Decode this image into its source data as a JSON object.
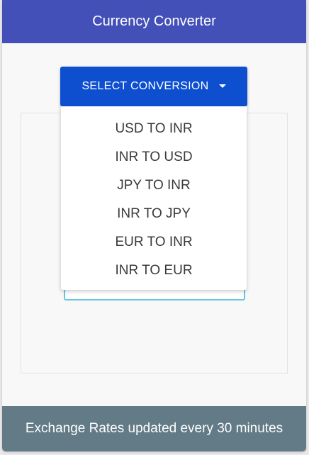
{
  "header": {
    "title": "Currency Converter"
  },
  "converter": {
    "select_label": "SELECT CONVERSION",
    "options": [
      "USD TO INR",
      "INR TO USD",
      "JPY TO INR",
      "INR TO JPY",
      "EUR TO INR",
      "INR TO EUR"
    ]
  },
  "footer": {
    "text": "Exchange Rates updated every 30 minutes"
  },
  "colors": {
    "header_bg": "#4350b8",
    "button_bg": "#0d4fcf",
    "footer_bg": "#627b87",
    "input_border": "#66c8e0"
  }
}
